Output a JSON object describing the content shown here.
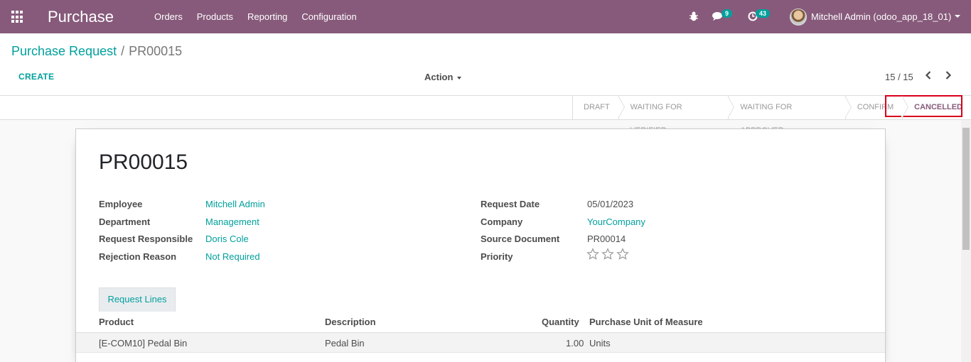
{
  "navbar": {
    "app_name": "Purchase",
    "menu": [
      "Orders",
      "Products",
      "Reporting",
      "Configuration"
    ],
    "messages_count": "9",
    "activities_count": "43",
    "user_name": "Mitchell Admin (odoo_app_18_01)"
  },
  "breadcrumb": {
    "parent": "Purchase Request",
    "separator": "/",
    "current": "PR00015"
  },
  "control": {
    "create_label": "CREATE",
    "action_label": "Action",
    "pager": "15 / 15"
  },
  "statusbar": {
    "stages": [
      "DRAFT",
      "WAITING FOR VERIFIER",
      "WAITING FOR APPROVER",
      "CONFIRM",
      "CANCELLED"
    ],
    "active": "CANCELLED"
  },
  "record": {
    "title": "PR00015",
    "left_fields": [
      {
        "label": "Employee",
        "value": "Mitchell Admin"
      },
      {
        "label": "Department",
        "value": "Management"
      },
      {
        "label": "Request Responsible",
        "value": "Doris Cole"
      },
      {
        "label": "Rejection Reason",
        "value": "Not Required"
      }
    ],
    "right_fields": [
      {
        "label": "Request Date",
        "value": "05/01/2023"
      },
      {
        "label": "Company",
        "value": "YourCompany"
      },
      {
        "label": "Source Document",
        "value": "PR00014"
      },
      {
        "label": "Priority",
        "value": ""
      }
    ],
    "priority_stars": 0
  },
  "tabs": {
    "request_lines": "Request Lines"
  },
  "lines": {
    "columns": [
      "Product",
      "Description",
      "Quantity",
      "Purchase Unit of Measure"
    ],
    "rows": [
      {
        "product": "[E-COM10] Pedal Bin",
        "description": "Pedal Bin",
        "quantity": "1.00",
        "uom": "Units"
      }
    ]
  },
  "colors": {
    "navbar": "#875a7b",
    "accent": "#00a09d",
    "highlight": "#d9001b"
  }
}
